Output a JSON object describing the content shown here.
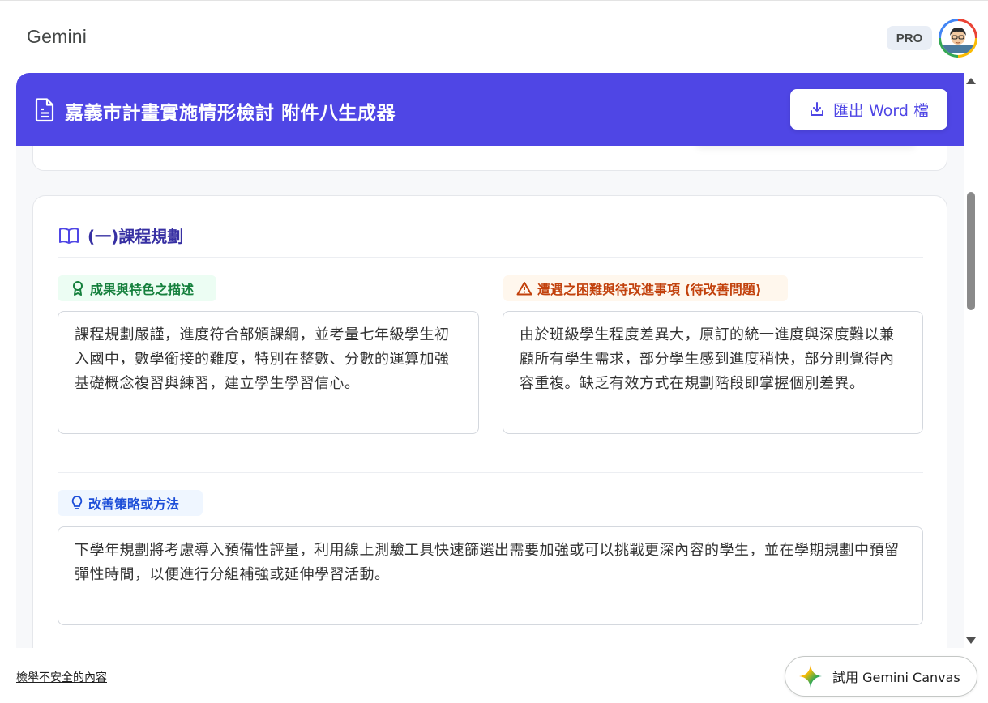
{
  "app": {
    "title": "Gemini",
    "badge": "PRO"
  },
  "header": {
    "title": "嘉義市計畫實施情形檢討 附件八生成器",
    "export_label": "匯出 Word 檔",
    "color": "#4f46e5"
  },
  "section": {
    "title": "(一)課程規劃",
    "achievements": {
      "label": "成果與特色之描述",
      "text": "課程規劃嚴謹，進度符合部頒課綱，並考量七年級學生初入國中，數學銜接的難度，特別在整數、分數的運算加強基礎概念複習與練習，建立學生學習信心。"
    },
    "difficulties": {
      "label": "遭遇之困難與待改進事項 (待改善問題)",
      "text": "由於班級學生程度差異大，原訂的統一進度與深度難以兼顧所有學生需求，部分學生感到進度稍快，部分則覺得內容重複。缺乏有效方式在規劃階段即掌握個別差異。"
    },
    "strategy": {
      "label": "改善策略或方法",
      "text": "下學年規劃將考慮導入預備性評量，利用線上測驗工具快速篩選出需要加強或可以挑戰更深內容的學生，並在學期規劃中預留彈性時間，以便進行分組補強或延伸學習活動。"
    }
  },
  "footer": {
    "report_link": "檢舉不安全的內容",
    "canvas_button": "試用 Gemini Canvas"
  },
  "icons": {
    "header": "document-icon",
    "export": "download-icon",
    "section": "book-open-icon",
    "achievements": "award-icon",
    "difficulties": "warning-icon",
    "strategy": "lightbulb-icon",
    "canvas": "gemini-sparkle-icon"
  }
}
